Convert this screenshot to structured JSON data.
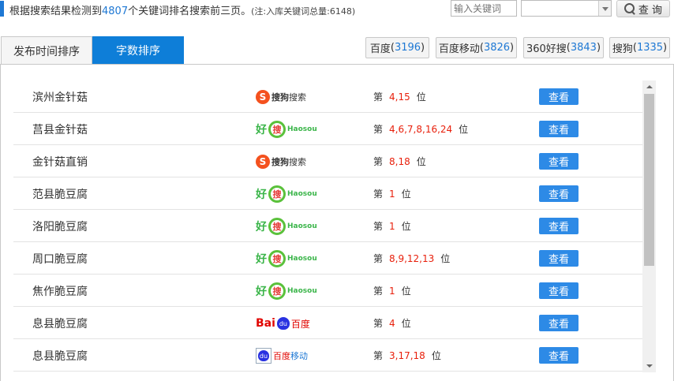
{
  "header": {
    "summary_prefix": "根据搜索结果检测到",
    "keyword_count": "4807",
    "summary_suffix": "个关键词排名搜索前三页。",
    "note": "(注:入库关键词总量:6148)",
    "search_placeholder": "输入关键词",
    "select_value": "",
    "query_label": "查 询"
  },
  "tabs": [
    {
      "label": "发布时间排序",
      "active": false
    },
    {
      "label": "字数排序",
      "active": true
    }
  ],
  "engines": [
    {
      "name": "百度",
      "count": "3196"
    },
    {
      "name": "百度移动",
      "count": "3826"
    },
    {
      "name": "360好搜",
      "count": "3843"
    },
    {
      "name": "搜狗",
      "count": "1335"
    }
  ],
  "rows": [
    {
      "keyword": "滨州金针菇",
      "engine": "sogou",
      "positions": "4,15",
      "rank_prefix": "第",
      "rank_suffix": "位",
      "action": "查看"
    },
    {
      "keyword": "莒县金针菇",
      "engine": "haosou",
      "positions": "4,6,7,8,16,24",
      "rank_prefix": "第",
      "rank_suffix": "位",
      "action": "查看"
    },
    {
      "keyword": "金针菇直销",
      "engine": "sogou",
      "positions": "8,18",
      "rank_prefix": "第",
      "rank_suffix": "位",
      "action": "查看"
    },
    {
      "keyword": "范县脆豆腐",
      "engine": "haosou",
      "positions": "1",
      "rank_prefix": "第",
      "rank_suffix": "位",
      "action": "查看"
    },
    {
      "keyword": "洛阳脆豆腐",
      "engine": "haosou",
      "positions": "1",
      "rank_prefix": "第",
      "rank_suffix": "位",
      "action": "查看"
    },
    {
      "keyword": "周口脆豆腐",
      "engine": "haosou",
      "positions": "8,9,12,13",
      "rank_prefix": "第",
      "rank_suffix": "位",
      "action": "查看"
    },
    {
      "keyword": "焦作脆豆腐",
      "engine": "haosou",
      "positions": "1",
      "rank_prefix": "第",
      "rank_suffix": "位",
      "action": "查看"
    },
    {
      "keyword": "息县脆豆腐",
      "engine": "baidu",
      "positions": "4",
      "rank_prefix": "第",
      "rank_suffix": "位",
      "action": "查看"
    },
    {
      "keyword": "息县脆豆腐",
      "engine": "baidu-mobile",
      "positions": "3,17,18",
      "rank_prefix": "第",
      "rank_suffix": "位",
      "action": "查看"
    }
  ],
  "logos": {
    "sogou": {
      "glyph": "S",
      "strong": "搜狗",
      "text": "搜索"
    },
    "haosou": {
      "hao": "好",
      "sou": "搜",
      "word": "Haosou"
    },
    "baidu": {
      "bai": "Bai",
      "paw": "du",
      "du": "百度"
    },
    "baidu-mobile": {
      "paw": "du",
      "red": "百度",
      "blue": "移动"
    }
  },
  "colors": {
    "accent": "#1e78d4",
    "button": "#2d8ae6",
    "rank": "#e8200c"
  }
}
